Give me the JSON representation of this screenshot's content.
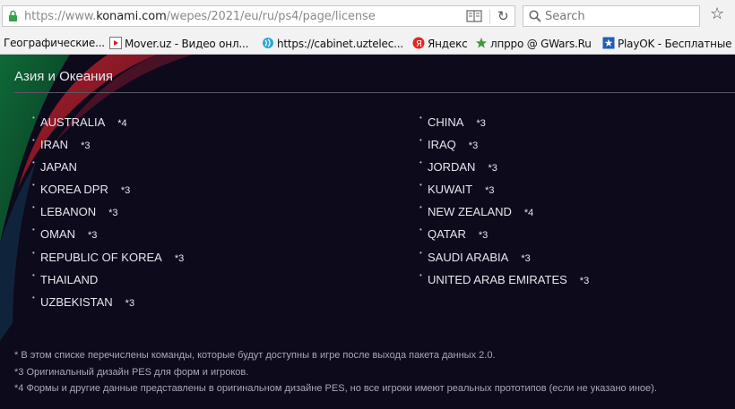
{
  "browser": {
    "url_prefix": "https://www.",
    "url_domain": "konami.com",
    "url_path": "/wepes/2021/eu/ru/ps4/page/license",
    "search_placeholder": "Search",
    "bookmarks": [
      {
        "label": "Географические..."
      },
      {
        "label": "Mover.uz - Видео онл..."
      },
      {
        "label": "https://cabinet.uztelec..."
      },
      {
        "label": "Яндекс"
      },
      {
        "label": "лпрро @ GWars.Ru"
      },
      {
        "label": "PlayOK - Бесплатные"
      }
    ]
  },
  "region": {
    "title": "Азия и Океания"
  },
  "countries_left": [
    {
      "name": "AUSTRALIA",
      "note": "*4"
    },
    {
      "name": "IRAN",
      "note": "*3"
    },
    {
      "name": "JAPAN",
      "note": ""
    },
    {
      "name": "KOREA DPR",
      "note": "*3"
    },
    {
      "name": "LEBANON",
      "note": "*3"
    },
    {
      "name": "OMAN",
      "note": "*3"
    },
    {
      "name": "REPUBLIC OF KOREA",
      "note": "*3"
    },
    {
      "name": "THAILAND",
      "note": ""
    },
    {
      "name": "UZBEKISTAN",
      "note": "*3"
    }
  ],
  "countries_right": [
    {
      "name": "CHINA",
      "note": "*3"
    },
    {
      "name": "IRAQ",
      "note": "*3"
    },
    {
      "name": "JORDAN",
      "note": "*3"
    },
    {
      "name": "KUWAIT",
      "note": "*3"
    },
    {
      "name": "NEW ZEALAND",
      "note": "*4"
    },
    {
      "name": "QATAR",
      "note": "*3"
    },
    {
      "name": "SAUDI ARABIA",
      "note": "*3"
    },
    {
      "name": "UNITED ARAB EMIRATES",
      "note": "*3"
    }
  ],
  "footnotes": [
    "* В этом списке перечислены команды, которые будут доступны в игре после выхода пакета данных 2.0.",
    "*3 Оригинальный дизайн PES для форм и игроков.",
    "*4 Формы и другие данные представлены в оригинальном дизайне PES, но все игроки имеют реальных прототипов (если не указано иное)."
  ],
  "colors": {
    "background": "#0c0a1b",
    "text": "#e6e6ee",
    "footnote": "#a9a8b8",
    "swoosh_red": "#b8202a",
    "swoosh_green": "#1f7a3a"
  }
}
